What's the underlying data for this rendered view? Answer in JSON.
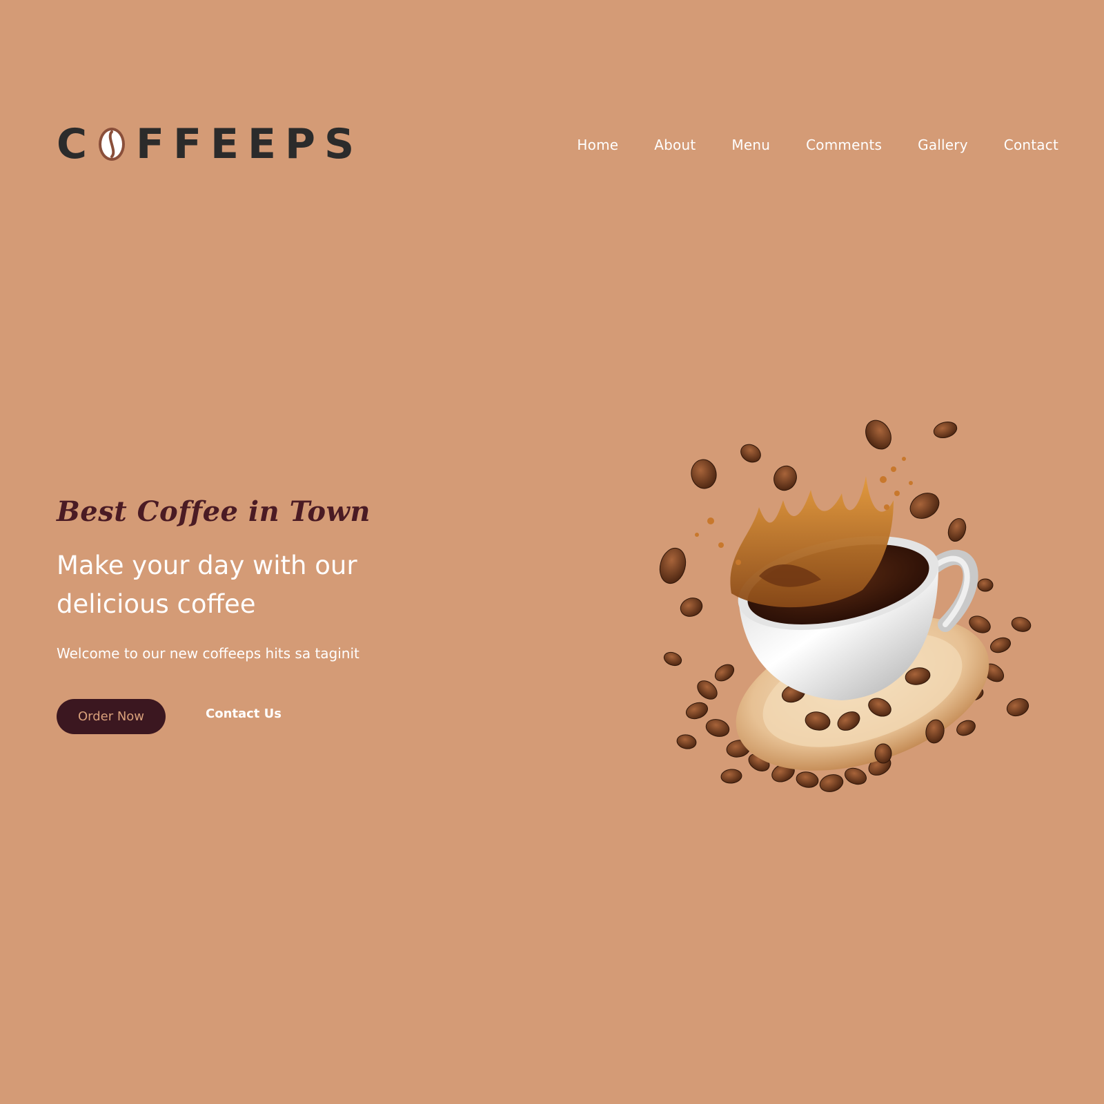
{
  "brand": {
    "name": "COFFEEPS",
    "logo_first": "C",
    "logo_rest": "FFEEPS"
  },
  "nav": {
    "items": [
      {
        "label": "Home"
      },
      {
        "label": "About"
      },
      {
        "label": "Menu"
      },
      {
        "label": "Comments"
      },
      {
        "label": "Gallery"
      },
      {
        "label": "Contact"
      }
    ]
  },
  "hero": {
    "tagline": "Best Coffee in Town",
    "headline": "Make your day with our delicious coffee",
    "subtext": "Welcome to our new coffeeps hits sa taginit",
    "primary_button": "Order Now",
    "secondary_button": "Contact Us",
    "image_icon": "coffee-cup-splash-illustration"
  },
  "colors": {
    "background": "#d49b76",
    "logo_text": "#2b2b2b",
    "tagline": "#4a1b24",
    "button_bg": "#3b1720",
    "button_text": "#d9a07b",
    "nav_text": "#ffffff"
  }
}
